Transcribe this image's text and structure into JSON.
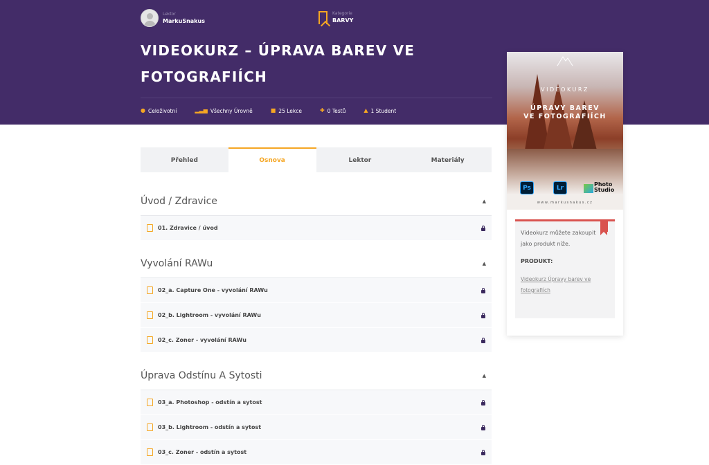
{
  "header": {
    "lektor_label": "Lektor",
    "lektor_name": "MarkuSnakus",
    "category_label": "Kategorie",
    "category_name": "BARVY",
    "title": "VIDEOKURZ – ÚPRAVA BAREV VE FOTOGRAFIÍCH",
    "stats": [
      {
        "icon": "clock-icon",
        "label": "Celoživotní"
      },
      {
        "icon": "levels-icon",
        "label": "Všechny Úrovně"
      },
      {
        "icon": "files-icon",
        "label": "25 Lekce"
      },
      {
        "icon": "puzzle-icon",
        "label": "0 Testů"
      },
      {
        "icon": "graduate-icon",
        "label": "1 Student"
      }
    ]
  },
  "tabs": [
    {
      "label": "Přehled",
      "active": false
    },
    {
      "label": "Osnova",
      "active": true
    },
    {
      "label": "Lektor",
      "active": false
    },
    {
      "label": "Materiály",
      "active": false
    }
  ],
  "curriculum": [
    {
      "title": "Úvod / Zdravice",
      "lessons": [
        "01. Zdravice / úvod"
      ]
    },
    {
      "title": "Vyvolání RAWu",
      "lessons": [
        "02_a. Capture One - vyvolání RAWu",
        "02_b. Lightroom - vyvolání RAWu",
        "02_c. Zoner - vyvolání RAWu"
      ]
    },
    {
      "title": "Úprava Odstínu A Sytosti",
      "lessons": [
        "03_a. Photoshop - odstín a sytost",
        "03_b. Lightroom - odstín a sytost",
        "03_c. Zoner - odstín a sytost"
      ]
    }
  ],
  "sidebar": {
    "cover": {
      "kicker": "VIDEOKURZ",
      "title_line1": "ÚPRAVY BAREV",
      "title_line2": "VE FOTOGRAFIÍCH",
      "apps": [
        "Ps",
        "Lr"
      ],
      "zoner_label": "Photo Studio",
      "website": "www.markusnakus.cz"
    },
    "notice_text": "Videokurz můžete zakoupit jako produkt níže.",
    "product_heading": "PRODUKT:",
    "product_link": "Videokurz Úpravy barev ve fotografiích"
  },
  "colors": {
    "header_bg": "#432c68",
    "accent": "#f5a623",
    "ribbon": "#d9534f"
  }
}
